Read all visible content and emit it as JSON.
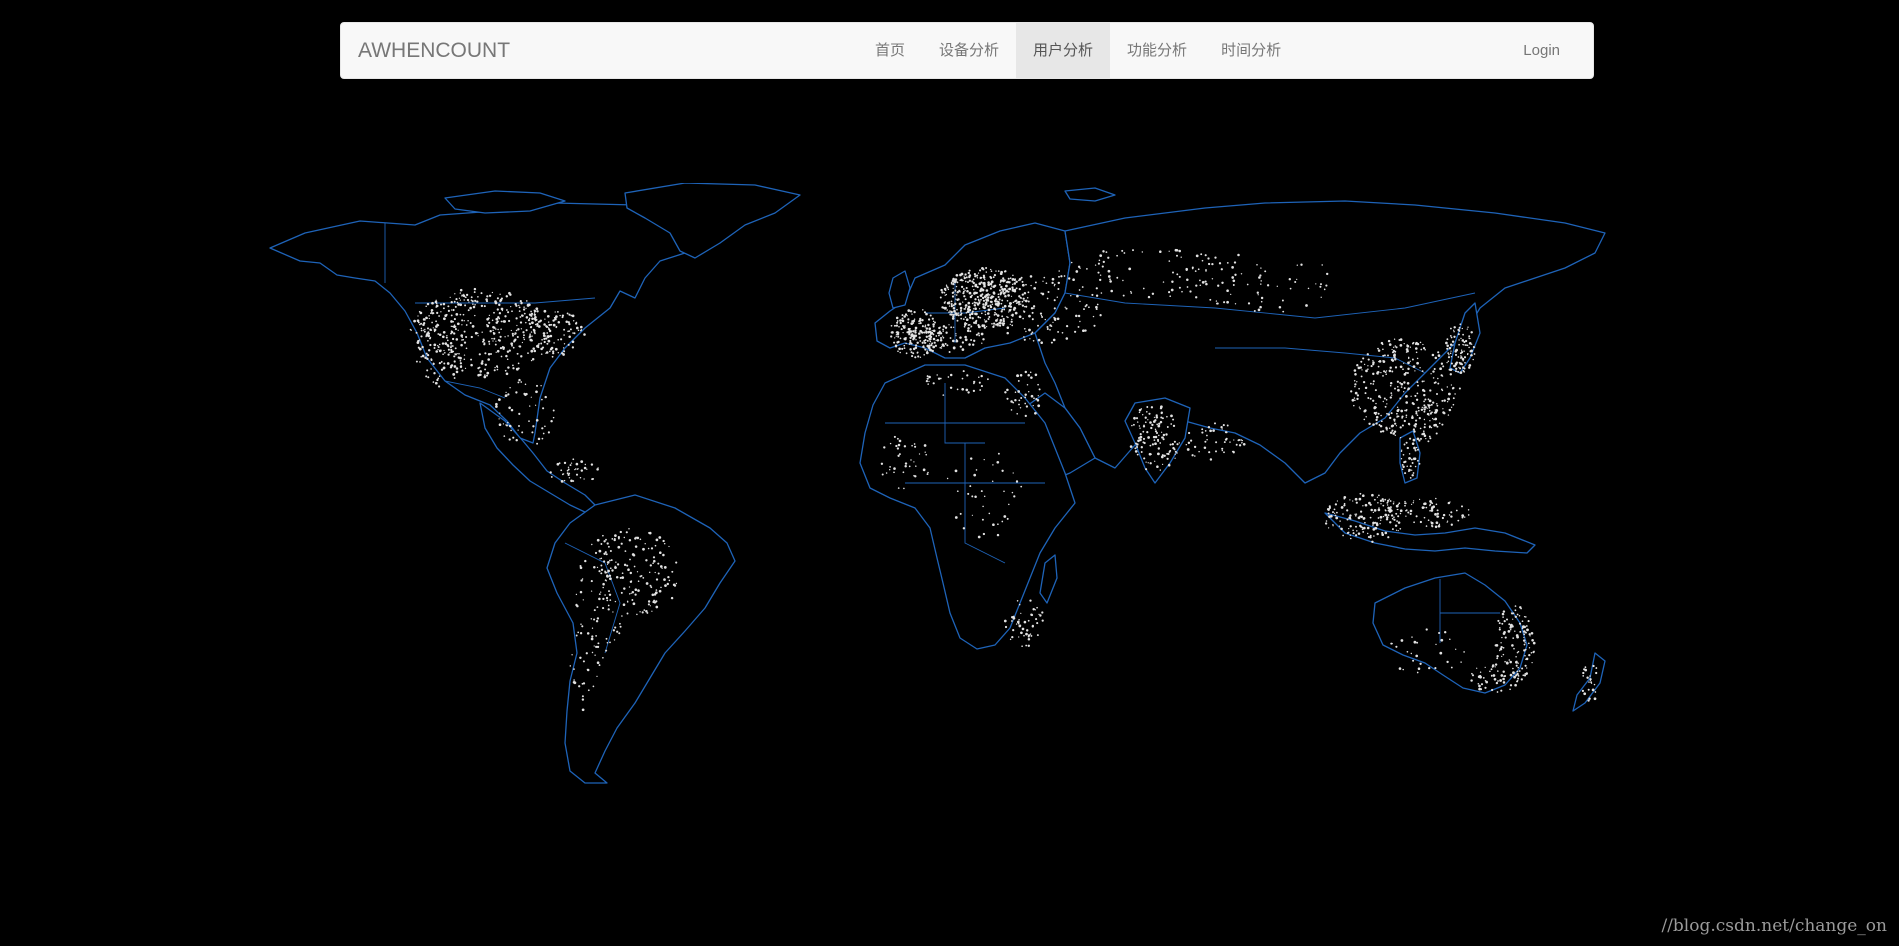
{
  "navbar": {
    "brand": "AWHENCOUNT",
    "items": [
      {
        "label": "首页",
        "active": false
      },
      {
        "label": "设备分析",
        "active": false
      },
      {
        "label": "用户分析",
        "active": true
      },
      {
        "label": "功能分析",
        "active": false
      },
      {
        "label": "时间分析",
        "active": false
      }
    ],
    "login": "Login"
  },
  "map": {
    "background": "#000000",
    "border_color": "#1e63b8",
    "point_color": "#e2e2e2"
  },
  "watermark": "//blog.csdn.net/change_on"
}
